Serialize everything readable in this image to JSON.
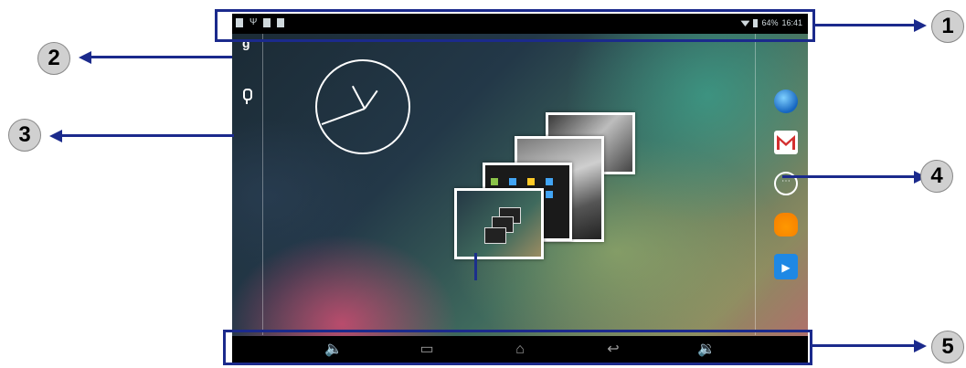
{
  "statusbar": {
    "battery_text": "64%",
    "time": "16:41"
  },
  "callouts": {
    "n1": "1",
    "n2": "2",
    "n3": "3",
    "n4": "4",
    "n5": "5"
  },
  "homescreen": {
    "search_glyph": "g",
    "left_icons": [
      "google-search-icon",
      "voice-search-icon"
    ],
    "dock_icons": [
      "browser-icon",
      "gmail-icon",
      "all-apps-icon",
      "play-music-icon",
      "play-movies-icon"
    ],
    "apps_glyph": "⋯",
    "video_glyph": "▶"
  },
  "navbar": {
    "volume_down_glyph": "🔈",
    "recents_glyph": "▭",
    "home_glyph": "⌂",
    "back_glyph": "↩",
    "volume_up_glyph": "🔉"
  },
  "colors": {
    "frame": "#1b2a8c",
    "callout_bg": "#d0d0d0"
  }
}
